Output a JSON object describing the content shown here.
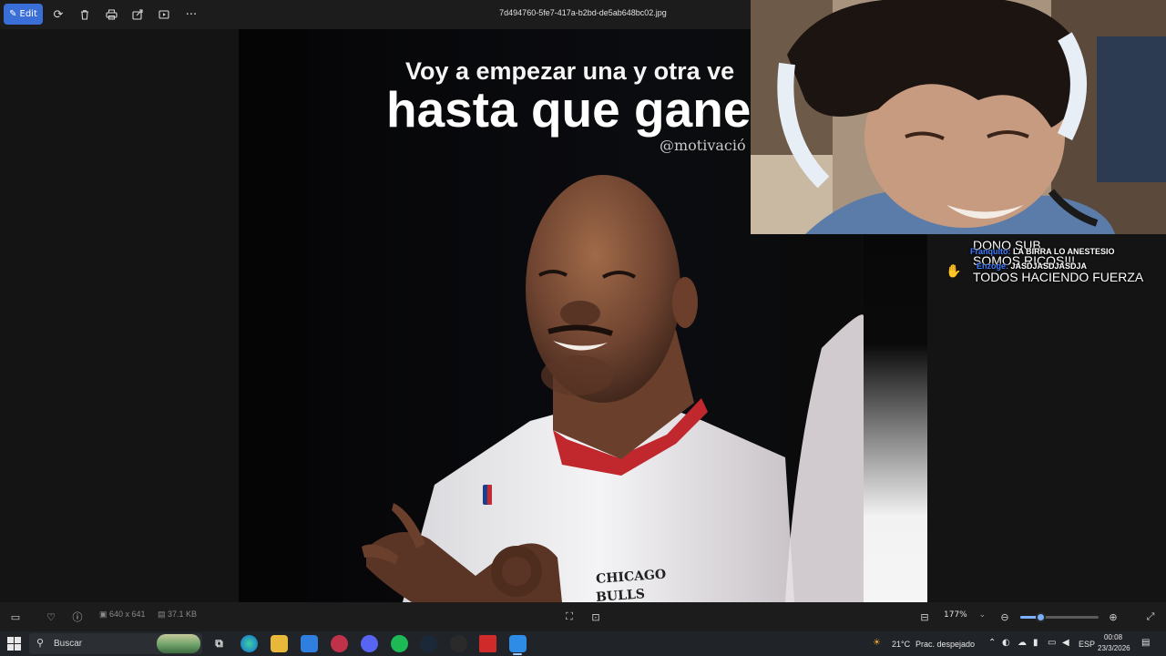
{
  "toolbar": {
    "edit_label": "Edit",
    "filename": "7d494760-5fe7-417a-b2bd-de5ab648bc02.jpg",
    "icons": [
      "edit-icon",
      "rotate-icon",
      "delete-icon",
      "print-icon",
      "share-icon",
      "slideshow-icon",
      "more-icon"
    ],
    "more_glyph": "···"
  },
  "image": {
    "quote_line1": "Voy a empezar una y otra ve",
    "quote_line2": "hasta que gane",
    "handle": "@motivació",
    "jersey_text1": "CHICAGO",
    "jersey_text2": "BULLS"
  },
  "chat": {
    "line1": "DONO SUB",
    "line2": "SOMOS RICOS!!!",
    "line3": "TODOS HACIENDO FUERZA",
    "msg1_user": "Franquito:",
    "msg1_text": "LA BIRRA LO ANESTESIO",
    "msg2_user": "Enzoge:",
    "msg2_text": "JASDJASDJASDJA"
  },
  "bottombar": {
    "dimensions": "640 x 641",
    "file_size": "37.1 KB",
    "zoom": "177%",
    "zoom_fraction": 0.25
  },
  "taskbar": {
    "search_label": "Buscar",
    "weather": "21°C",
    "weather_desc": "Prac. despejado",
    "language": "ESP",
    "time": "00:08",
    "date": "23/3/2026"
  },
  "colors": {
    "accent": "#3a6fd8",
    "chat_user": "#3f7cff",
    "taskbar": "#202328"
  }
}
